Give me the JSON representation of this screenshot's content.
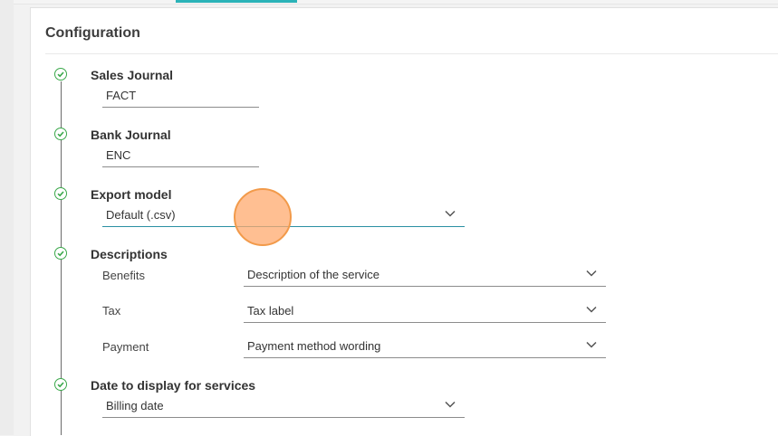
{
  "section": {
    "title": "Configuration"
  },
  "steps": {
    "sales_journal": {
      "label": "Sales Journal",
      "value": "FACT"
    },
    "bank_journal": {
      "label": "Bank Journal",
      "value": "ENC"
    },
    "export_model": {
      "label": "Export model",
      "value": "Default (.csv)"
    },
    "descriptions": {
      "label": "Descriptions",
      "rows": [
        {
          "label": "Benefits",
          "value": "Description of the service"
        },
        {
          "label": "Tax",
          "value": "Tax label"
        },
        {
          "label": "Payment",
          "value": "Payment method wording"
        }
      ]
    },
    "date_display": {
      "label": "Date to display for services",
      "value": "Billing date"
    }
  },
  "icons": {
    "step_status": "check-circle-icon",
    "dropdown": "chevron-down-icon"
  },
  "colors": {
    "accent": "#2bb3b8",
    "success": "#3aa84a",
    "cursor": "#f29a4a"
  }
}
